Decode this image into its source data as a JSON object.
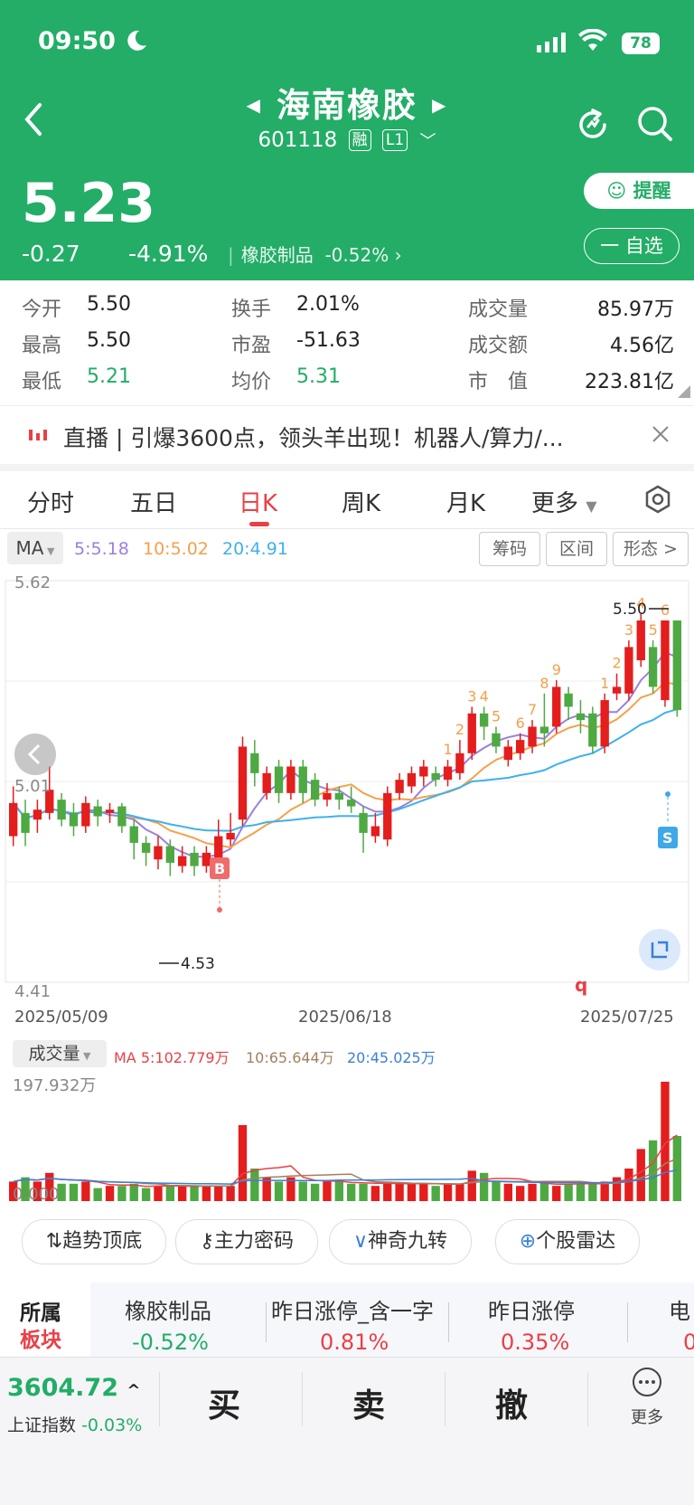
{
  "status": {
    "time": "09:50",
    "battery": "78"
  },
  "header": {
    "name": "海南橡胶",
    "code": "601118",
    "tag_margin": "融",
    "tag_level": "L1",
    "price": "5.23",
    "change": "-0.27",
    "change_pct": "-4.91%",
    "sector_label": "橡胶制品",
    "sector_pct": "-0.52%",
    "remind_label": "提醒",
    "fav_label": "一 自选"
  },
  "stats": {
    "open_label": "今开",
    "open": "5.50",
    "high_label": "最高",
    "high": "5.50",
    "low_label": "最低",
    "low": "5.21",
    "turnover_label": "换手",
    "turnover": "2.01%",
    "pe_label": "市盈",
    "pe": "-51.63",
    "avg_label": "均价",
    "avg": "5.31",
    "vol_label": "成交量",
    "vol": "85.97万",
    "amount_label": "成交额",
    "amount": "4.56亿",
    "mcap_label": "市　值",
    "mcap": "223.81亿"
  },
  "ticker": {
    "text": "直播 | 引爆3600点，领头羊出现！机器人/算力/..."
  },
  "tabs": [
    "分时",
    "五日",
    "日K",
    "周K",
    "月K",
    "更多"
  ],
  "ma": {
    "label": "MA",
    "ma5": "5:5.18",
    "ma10": "10:5.02",
    "ma20": "20:4.91",
    "btn_chip": "筹码",
    "btn_range": "区间",
    "btn_shape": "形态 >",
    "colors": {
      "ma5": "#9b7fe0",
      "ma10": "#f4a04a",
      "ma20": "#3fb0ef"
    }
  },
  "chart_data": {
    "type": "candlestick",
    "y_top": "5.62",
    "y_mid": "5.01",
    "y_bottom": "4.41",
    "ylim": [
      4.41,
      5.62
    ],
    "dates": [
      "2025/05/09",
      "2025/06/18",
      "2025/07/25"
    ],
    "high_marker": "5.50",
    "low_marker": "4.53",
    "buy_marker": "B",
    "sell_marker": "S",
    "q_marker": "q",
    "up_color": "#e41d1d",
    "down_color": "#4ea943",
    "candles": [
      [
        4.85,
        4.95,
        4.82,
        5.0
      ],
      [
        4.92,
        4.86,
        4.82,
        4.96
      ],
      [
        4.9,
        4.93,
        4.86,
        4.96
      ],
      [
        4.92,
        4.99,
        4.9,
        5.06
      ],
      [
        4.96,
        4.9,
        4.88,
        4.98
      ],
      [
        4.92,
        4.88,
        4.85,
        4.95
      ],
      [
        4.88,
        4.95,
        4.86,
        4.97
      ],
      [
        4.94,
        4.91,
        4.88,
        4.96
      ],
      [
        4.92,
        4.93,
        4.89,
        4.95
      ],
      [
        4.94,
        4.88,
        4.86,
        4.95
      ],
      [
        4.88,
        4.83,
        4.78,
        4.9
      ],
      [
        4.83,
        4.8,
        4.76,
        4.85
      ],
      [
        4.78,
        4.82,
        4.75,
        4.85
      ],
      [
        4.82,
        4.77,
        4.73,
        4.84
      ],
      [
        4.76,
        4.79,
        4.74,
        4.82
      ],
      [
        4.8,
        4.76,
        4.73,
        4.82
      ],
      [
        4.76,
        4.8,
        4.74,
        4.82
      ],
      [
        4.78,
        4.85,
        4.76,
        4.9
      ],
      [
        4.84,
        4.86,
        4.82,
        4.92
      ],
      [
        4.9,
        5.12,
        4.88,
        5.15
      ],
      [
        5.1,
        5.04,
        5.0,
        5.14
      ],
      [
        4.98,
        5.04,
        4.96,
        5.06
      ],
      [
        5.06,
        4.98,
        4.95,
        5.08
      ],
      [
        4.98,
        5.06,
        4.96,
        5.08
      ],
      [
        5.06,
        4.98,
        4.95,
        5.08
      ],
      [
        5.02,
        4.96,
        4.94,
        5.04
      ],
      [
        4.96,
        4.98,
        4.94,
        5.01
      ],
      [
        4.98,
        4.96,
        4.93,
        5.0
      ],
      [
        4.96,
        4.94,
        4.92,
        5.0
      ],
      [
        4.92,
        4.86,
        4.8,
        4.94
      ],
      [
        4.85,
        4.88,
        4.83,
        4.92
      ],
      [
        4.84,
        4.98,
        4.82,
        5.0
      ],
      [
        4.98,
        5.02,
        4.96,
        5.04
      ],
      [
        5.0,
        5.04,
        4.98,
        5.06
      ],
      [
        5.03,
        5.06,
        5.0,
        5.08
      ],
      [
        5.04,
        5.02,
        5.0,
        5.06
      ],
      [
        5.02,
        5.06,
        5.0,
        5.08
      ],
      [
        5.04,
        5.1,
        5.02,
        5.14
      ],
      [
        5.1,
        5.22,
        5.08,
        5.24
      ],
      [
        5.22,
        5.18,
        5.14,
        5.24
      ],
      [
        5.16,
        5.12,
        5.1,
        5.18
      ],
      [
        5.08,
        5.12,
        5.06,
        5.14
      ],
      [
        5.1,
        5.14,
        5.08,
        5.16
      ],
      [
        5.12,
        5.18,
        5.1,
        5.2
      ],
      [
        5.18,
        5.16,
        5.12,
        5.28
      ],
      [
        5.18,
        5.3,
        5.16,
        5.32
      ],
      [
        5.28,
        5.24,
        5.2,
        5.3
      ],
      [
        5.22,
        5.2,
        5.16,
        5.26
      ],
      [
        5.22,
        5.12,
        5.1,
        5.24
      ],
      [
        5.12,
        5.26,
        5.1,
        5.28
      ],
      [
        5.28,
        5.3,
        5.26,
        5.34
      ],
      [
        5.28,
        5.42,
        5.26,
        5.44
      ],
      [
        5.38,
        5.5,
        5.36,
        5.52
      ],
      [
        5.42,
        5.3,
        5.28,
        5.44
      ],
      [
        5.26,
        5.5,
        5.24,
        5.5
      ],
      [
        5.5,
        5.23,
        5.21,
        5.5
      ]
    ],
    "nine_counts": [
      {
        "i": 36,
        "t": "1"
      },
      {
        "i": 37,
        "t": "2"
      },
      {
        "i": 38,
        "t": "3"
      },
      {
        "i": 39,
        "t": "4"
      },
      {
        "i": 40,
        "t": "5"
      },
      {
        "i": 42,
        "t": "6"
      },
      {
        "i": 43,
        "t": "7"
      },
      {
        "i": 44,
        "t": "8"
      },
      {
        "i": 45,
        "t": "9"
      },
      {
        "i": 49,
        "t": "1"
      },
      {
        "i": 50,
        "t": "2"
      },
      {
        "i": 51,
        "t": "3"
      },
      {
        "i": 52,
        "t": "4"
      },
      {
        "i": 53,
        "t": "5"
      },
      {
        "i": 54,
        "t": "6"
      }
    ]
  },
  "volume": {
    "label": "成交量",
    "ma_label": "MA 5:102.779万",
    "ma10": "10:65.644万",
    "ma20": "20:45.025万",
    "max": "197.932万",
    "zero": "0.000",
    "values": [
      18,
      22,
      18,
      26,
      16,
      16,
      18,
      12,
      14,
      14,
      16,
      12,
      14,
      14,
      14,
      14,
      14,
      14,
      14,
      70,
      30,
      22,
      18,
      22,
      18,
      16,
      18,
      18,
      16,
      16,
      14,
      18,
      16,
      16,
      16,
      14,
      16,
      16,
      28,
      26,
      18,
      16,
      14,
      16,
      18,
      14,
      16,
      16,
      16,
      18,
      22,
      30,
      48,
      56,
      110,
      60
    ]
  },
  "tools": [
    "趋势顶底",
    "主力密码",
    "神奇九转",
    "个股雷达"
  ],
  "sectors": {
    "head1": "所属",
    "head2": "板块",
    "items": [
      {
        "name": "橡胶制品",
        "pct": "-0.52%"
      },
      {
        "name": "昨日涨停_含一字",
        "pct": "0.81%"
      },
      {
        "name": "昨日涨停",
        "pct": "0.35%"
      },
      {
        "name": "电",
        "pct": "0"
      }
    ]
  },
  "bottom": {
    "index_value": "3604.72",
    "index_name": "上证指数",
    "index_pct": "-0.03%",
    "buy": "买",
    "sell": "卖",
    "cancel": "撤",
    "more": "更多"
  }
}
